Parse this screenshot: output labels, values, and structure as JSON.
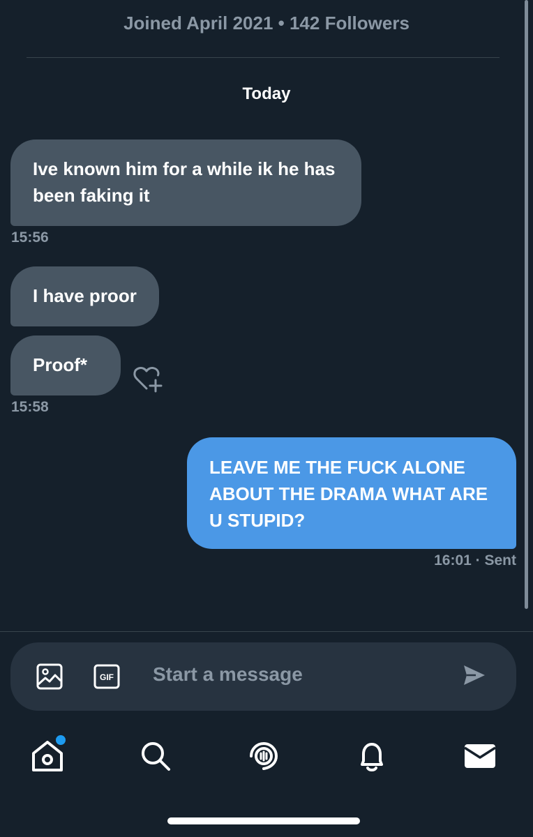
{
  "header": {
    "profile_meta": "Joined April 2021 • 142 Followers",
    "date_separator": "Today"
  },
  "messages": [
    {
      "direction": "received",
      "text": "Ive known him for a while ik he has been faking it",
      "time": "15:56"
    },
    {
      "direction": "received",
      "text": "I have proor"
    },
    {
      "direction": "received",
      "text": "Proof*",
      "time": "15:58"
    },
    {
      "direction": "sent",
      "text": "LEAVE ME THE FUCK ALONE ABOUT THE DRAMA WHAT ARE U STUPID?",
      "time": "16:01 · Sent"
    }
  ],
  "composer": {
    "placeholder": "Start a message",
    "icons": [
      "image-icon",
      "gif-icon",
      "send-icon"
    ]
  },
  "tabbar": {
    "items": [
      "home-icon",
      "search-icon",
      "spaces-icon",
      "notifications-icon",
      "messages-icon"
    ],
    "active": "messages",
    "home_badge": true
  },
  "colors": {
    "background": "#15202b",
    "received_bubble": "#485663",
    "sent_bubble": "#4b98e6",
    "muted_text": "#8b98a5",
    "accent": "#1d9bf0"
  }
}
